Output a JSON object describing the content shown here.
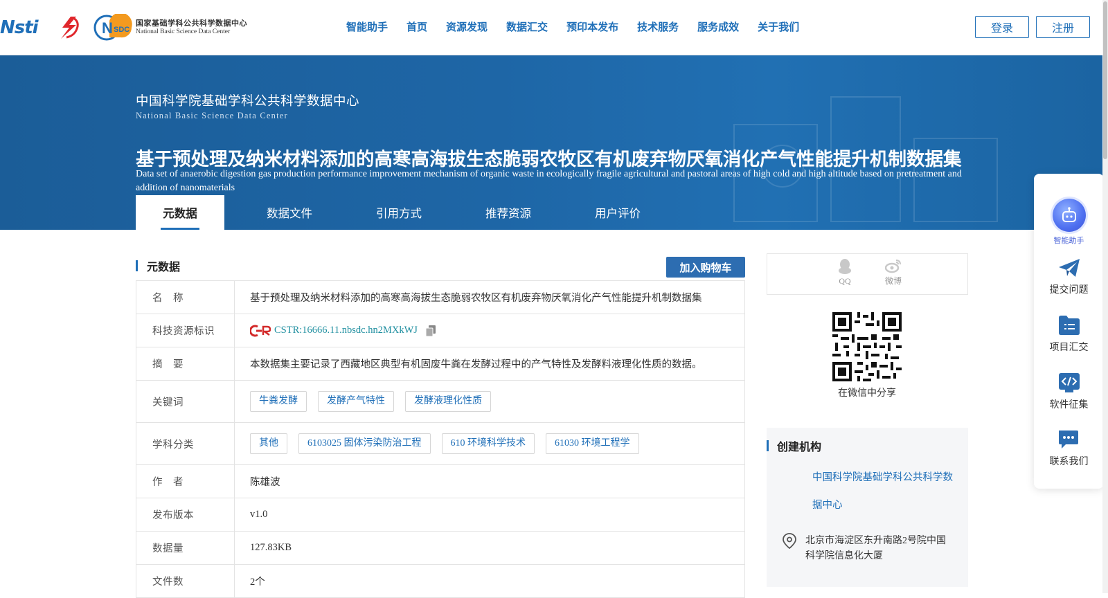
{
  "header": {
    "logos": {
      "nsti": "Nsti",
      "nsdc_cn": "国家基础学科公共科学数据中心",
      "nsdc_en": "National Basic Science Data Center"
    },
    "nav": [
      "智能助手",
      "首页",
      "资源发现",
      "数据汇交",
      "预印本发布",
      "技术服务",
      "服务成效",
      "关于我们"
    ],
    "login": "登录",
    "register": "注册"
  },
  "banner": {
    "org_cn": "中国科学院基础学科公共科学数据中心",
    "org_en": "National Basic Science Data Center",
    "title_cn": "基于预处理及纳米材料添加的高寒高海拔生态脆弱农牧区有机废弃物厌氧消化产气性能提升机制数据集",
    "title_en": "Data set of anaerobic digestion gas production performance improvement mechanism of organic waste in ecologically fragile agricultural and pastoral areas of high cold and high altitude based on pretreatment and addition of nanomaterials",
    "tabs": [
      "元数据",
      "数据文件",
      "引用方式",
      "推荐资源",
      "用户评价"
    ],
    "active_tab": "元数据"
  },
  "metadata": {
    "section_title": "元数据",
    "cart_button": "加入购物车",
    "rows": {
      "name_label": "名　称",
      "name_value": "基于预处理及纳米材料添加的高寒高海拔生态脆弱农牧区有机废弃物厌氧消化产气性能提升机制数据集",
      "id_label": "科技资源标识",
      "id_value": "CSTR:16666.11.nbsdc.hn2MXkWJ",
      "abstract_label": "摘　要",
      "abstract_value": "本数据集主要记录了西藏地区典型有机固废牛粪在发酵过程中的产气特性及发酵料液理化性质的数据。",
      "keywords_label": "关键词",
      "keywords": [
        "牛粪发酵",
        "发酵产气特性",
        "发酵液理化性质"
      ],
      "subject_label": "学科分类",
      "subjects": [
        "其他",
        "6103025 固体污染防治工程",
        "610 环境科学技术",
        "61030 环境工程学"
      ],
      "author_label": "作　者",
      "author_value": "陈雄波",
      "version_label": "发布版本",
      "version_value": "v1.0",
      "size_label": "数据量",
      "size_value": "127.83KB",
      "files_label": "文件数",
      "files_value": "2个"
    }
  },
  "share": {
    "qq": "QQ",
    "weibo": "微博",
    "wechat_label": "在微信中分享"
  },
  "creator": {
    "title": "创建机构",
    "org_line1": "中国科学院基础学科公共科学数",
    "org_line2": "据中心",
    "address": "北京市海淀区东升南路2号院中国科学院信息化大厦"
  },
  "float_panel": {
    "items": [
      "智能助手",
      "提交问题",
      "项目汇交",
      "软件征集",
      "联系我们"
    ]
  },
  "colors": {
    "primary": "#1f6fb8",
    "banner": "#1e66a6",
    "cart": "#2d6db1",
    "ai_accent": "#4a63d8"
  }
}
